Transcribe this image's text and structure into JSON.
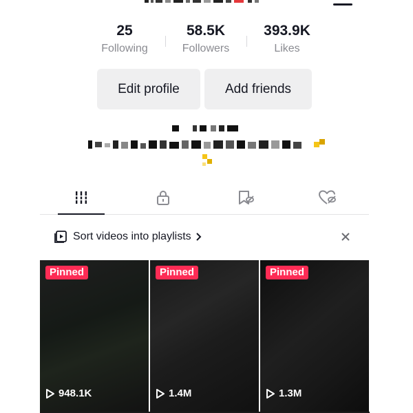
{
  "stats": [
    {
      "value": "25",
      "label": "Following"
    },
    {
      "value": "58.5K",
      "label": "Followers"
    },
    {
      "value": "393.9K",
      "label": "Likes"
    }
  ],
  "buttons": {
    "edit_profile": "Edit profile",
    "add_friends": "Add friends"
  },
  "tabs": [
    {
      "icon": "videos-grid-icon",
      "active": true
    },
    {
      "icon": "lock-icon",
      "active": false
    },
    {
      "icon": "favorites-hidden-icon",
      "active": false
    },
    {
      "icon": "liked-hidden-icon",
      "active": false
    }
  ],
  "playlist": {
    "text": "Sort videos into playlists"
  },
  "videos": [
    {
      "badge": "Pinned",
      "views": "948.1K"
    },
    {
      "badge": "Pinned",
      "views": "1.4M"
    },
    {
      "badge": "Pinned",
      "views": "1.3M"
    }
  ],
  "colors": {
    "accent": "#fe2c55",
    "text": "#161823",
    "muted": "#8a8b91",
    "button_bg": "#efeff0"
  }
}
